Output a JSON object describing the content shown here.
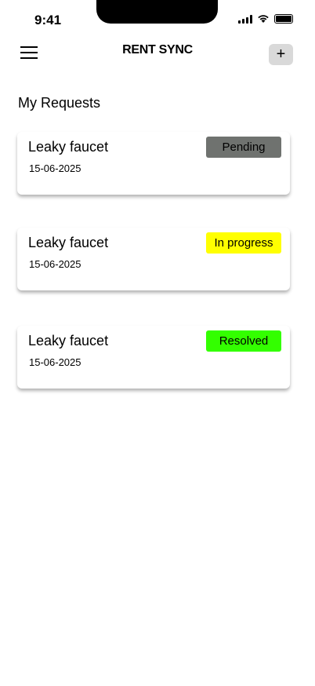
{
  "status_bar": {
    "time": "9:41"
  },
  "header": {
    "title": "RENT SYNC",
    "add_label": "+"
  },
  "page": {
    "heading": "My Requests"
  },
  "requests": [
    {
      "title": "Leaky faucet",
      "date": "15-06-2025",
      "status": "Pending",
      "color": "#6f726f"
    },
    {
      "title": "Leaky faucet",
      "date": "15-06-2025",
      "status": "In progress",
      "color": "#ffff00"
    },
    {
      "title": "Leaky faucet",
      "date": "15-06-2025",
      "status": "Resolved",
      "color": "#33ff00"
    }
  ]
}
